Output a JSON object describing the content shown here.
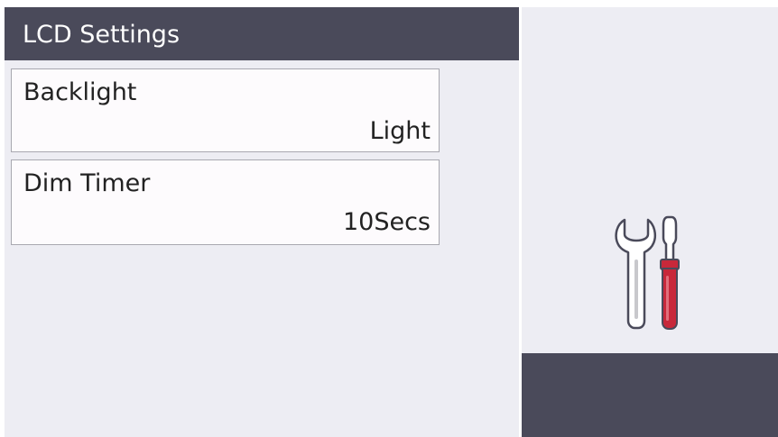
{
  "header": {
    "title": "LCD Settings"
  },
  "menu": {
    "items": [
      {
        "label": "Backlight",
        "value": "Light"
      },
      {
        "label": "Dim Timer",
        "value": "10Secs"
      }
    ]
  },
  "icons": {
    "tools": "wrench-screwdriver-icon"
  },
  "colors": {
    "header_bg": "#4a4a5a",
    "screen_bg": "#ededf3",
    "item_bg": "#fdfbfd",
    "screwdriver_handle": "#c8283a"
  }
}
